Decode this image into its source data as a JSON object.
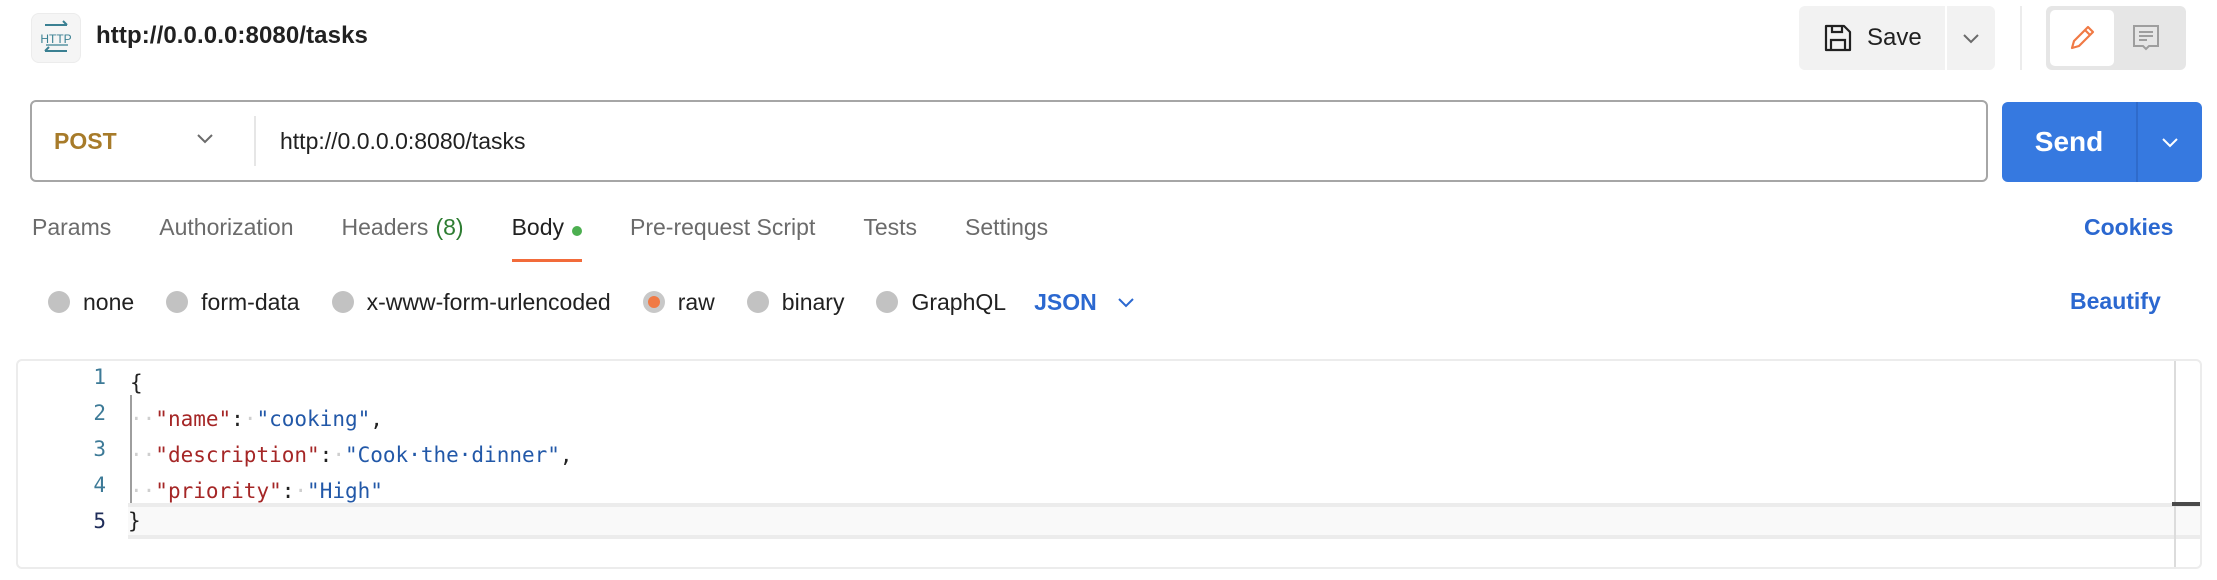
{
  "header": {
    "icon": "http-icon",
    "icon_text": "HTTP",
    "title": "http://0.0.0.0:8080/tasks",
    "save_label": "Save"
  },
  "request": {
    "method": "POST",
    "url": "http://0.0.0.0:8080/tasks",
    "send_label": "Send"
  },
  "tabs": [
    {
      "label": "Params"
    },
    {
      "label": "Authorization"
    },
    {
      "label": "Headers",
      "count": "(8)"
    },
    {
      "label": "Body",
      "active": true,
      "indicator": "green-dot"
    },
    {
      "label": "Pre-request Script"
    },
    {
      "label": "Tests"
    },
    {
      "label": "Settings"
    }
  ],
  "cookies_label": "Cookies",
  "body_options": {
    "modes": [
      {
        "label": "none",
        "checked": false
      },
      {
        "label": "form-data",
        "checked": false
      },
      {
        "label": "x-www-form-urlencoded",
        "checked": false
      },
      {
        "label": "raw",
        "checked": true
      },
      {
        "label": "binary",
        "checked": false
      },
      {
        "label": "GraphQL",
        "checked": false
      }
    ],
    "format": "JSON",
    "beautify_label": "Beautify"
  },
  "editor": {
    "lines": [
      {
        "no": "1",
        "text": "{"
      },
      {
        "no": "2",
        "key": "\"name\"",
        "value": "\"cooking\"",
        "trail": ","
      },
      {
        "no": "3",
        "key": "\"description\"",
        "value": "\"Cook·the·dinner\"",
        "trail": ","
      },
      {
        "no": "4",
        "key": "\"priority\"",
        "value": "\"High\"",
        "trail": ""
      },
      {
        "no": "5",
        "text": "}"
      }
    ]
  },
  "colors": {
    "accent_blue": "#3679e0",
    "link_blue": "#2b68d0",
    "method_post": "#a77b2a",
    "active_tab_underline": "#f26b3a",
    "body_indicator": "#4caf50",
    "headers_count": "#2e7d32",
    "json_key": "#a52626",
    "json_string": "#2258a8"
  }
}
